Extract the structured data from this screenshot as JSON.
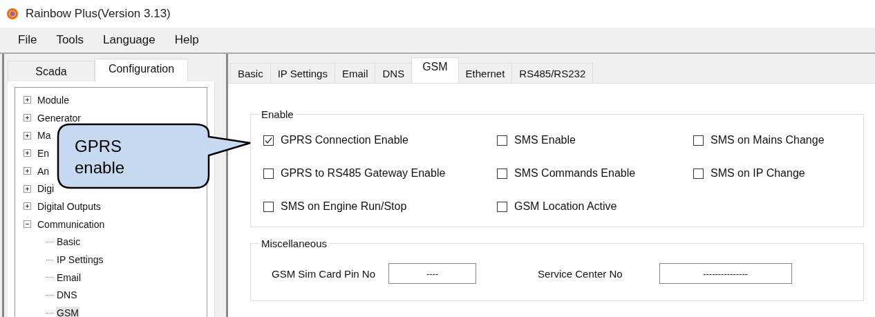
{
  "window": {
    "title": "Rainbow Plus(Version 3.13)"
  },
  "menu": [
    "File",
    "Tools",
    "Language",
    "Help"
  ],
  "left_tabs": [
    {
      "label": "Scada",
      "selected": false
    },
    {
      "label": "Configuration",
      "selected": true
    }
  ],
  "tree": [
    {
      "label": "Module",
      "expanded": false
    },
    {
      "label": "Generator",
      "expanded": false
    },
    {
      "label": "Ma",
      "expanded": false
    },
    {
      "label": "En",
      "expanded": false
    },
    {
      "label": "An",
      "expanded": false
    },
    {
      "label": "Digi",
      "expanded": false
    },
    {
      "label": "Digital Outputs",
      "expanded": false
    },
    {
      "label": "Communication",
      "expanded": true,
      "children": [
        {
          "label": "Basic",
          "selected": false
        },
        {
          "label": "IP Settings",
          "selected": false
        },
        {
          "label": "Email",
          "selected": false
        },
        {
          "label": "DNS",
          "selected": false
        },
        {
          "label": "GSM",
          "selected": true
        }
      ]
    }
  ],
  "tabs": [
    {
      "label": "Basic",
      "selected": false
    },
    {
      "label": "IP Settings",
      "selected": false
    },
    {
      "label": "Email",
      "selected": false
    },
    {
      "label": "DNS",
      "selected": false
    },
    {
      "label": "GSM",
      "selected": true
    },
    {
      "label": "Ethernet",
      "selected": false
    },
    {
      "label": "RS485/RS232",
      "selected": false
    }
  ],
  "enable_group": {
    "title": "Enable",
    "options": [
      {
        "label": "GPRS Connection Enable",
        "checked": true
      },
      {
        "label": "SMS Enable",
        "checked": false
      },
      {
        "label": "SMS on Mains Change",
        "checked": false
      },
      {
        "label": "GPRS to RS485 Gateway Enable",
        "checked": false
      },
      {
        "label": "SMS Commands Enable",
        "checked": false
      },
      {
        "label": "SMS on IP Change",
        "checked": false
      },
      {
        "label": "SMS on Engine Run/Stop",
        "checked": false
      },
      {
        "label": "GSM Location Active",
        "checked": false
      }
    ]
  },
  "misc_group": {
    "title": "Miscellaneous",
    "fields": [
      {
        "label": "GSM Sim Card Pin No",
        "value": "----"
      },
      {
        "label": "Service Center No",
        "value": "---------------"
      }
    ]
  },
  "callout": {
    "text": "GPRS enable"
  }
}
